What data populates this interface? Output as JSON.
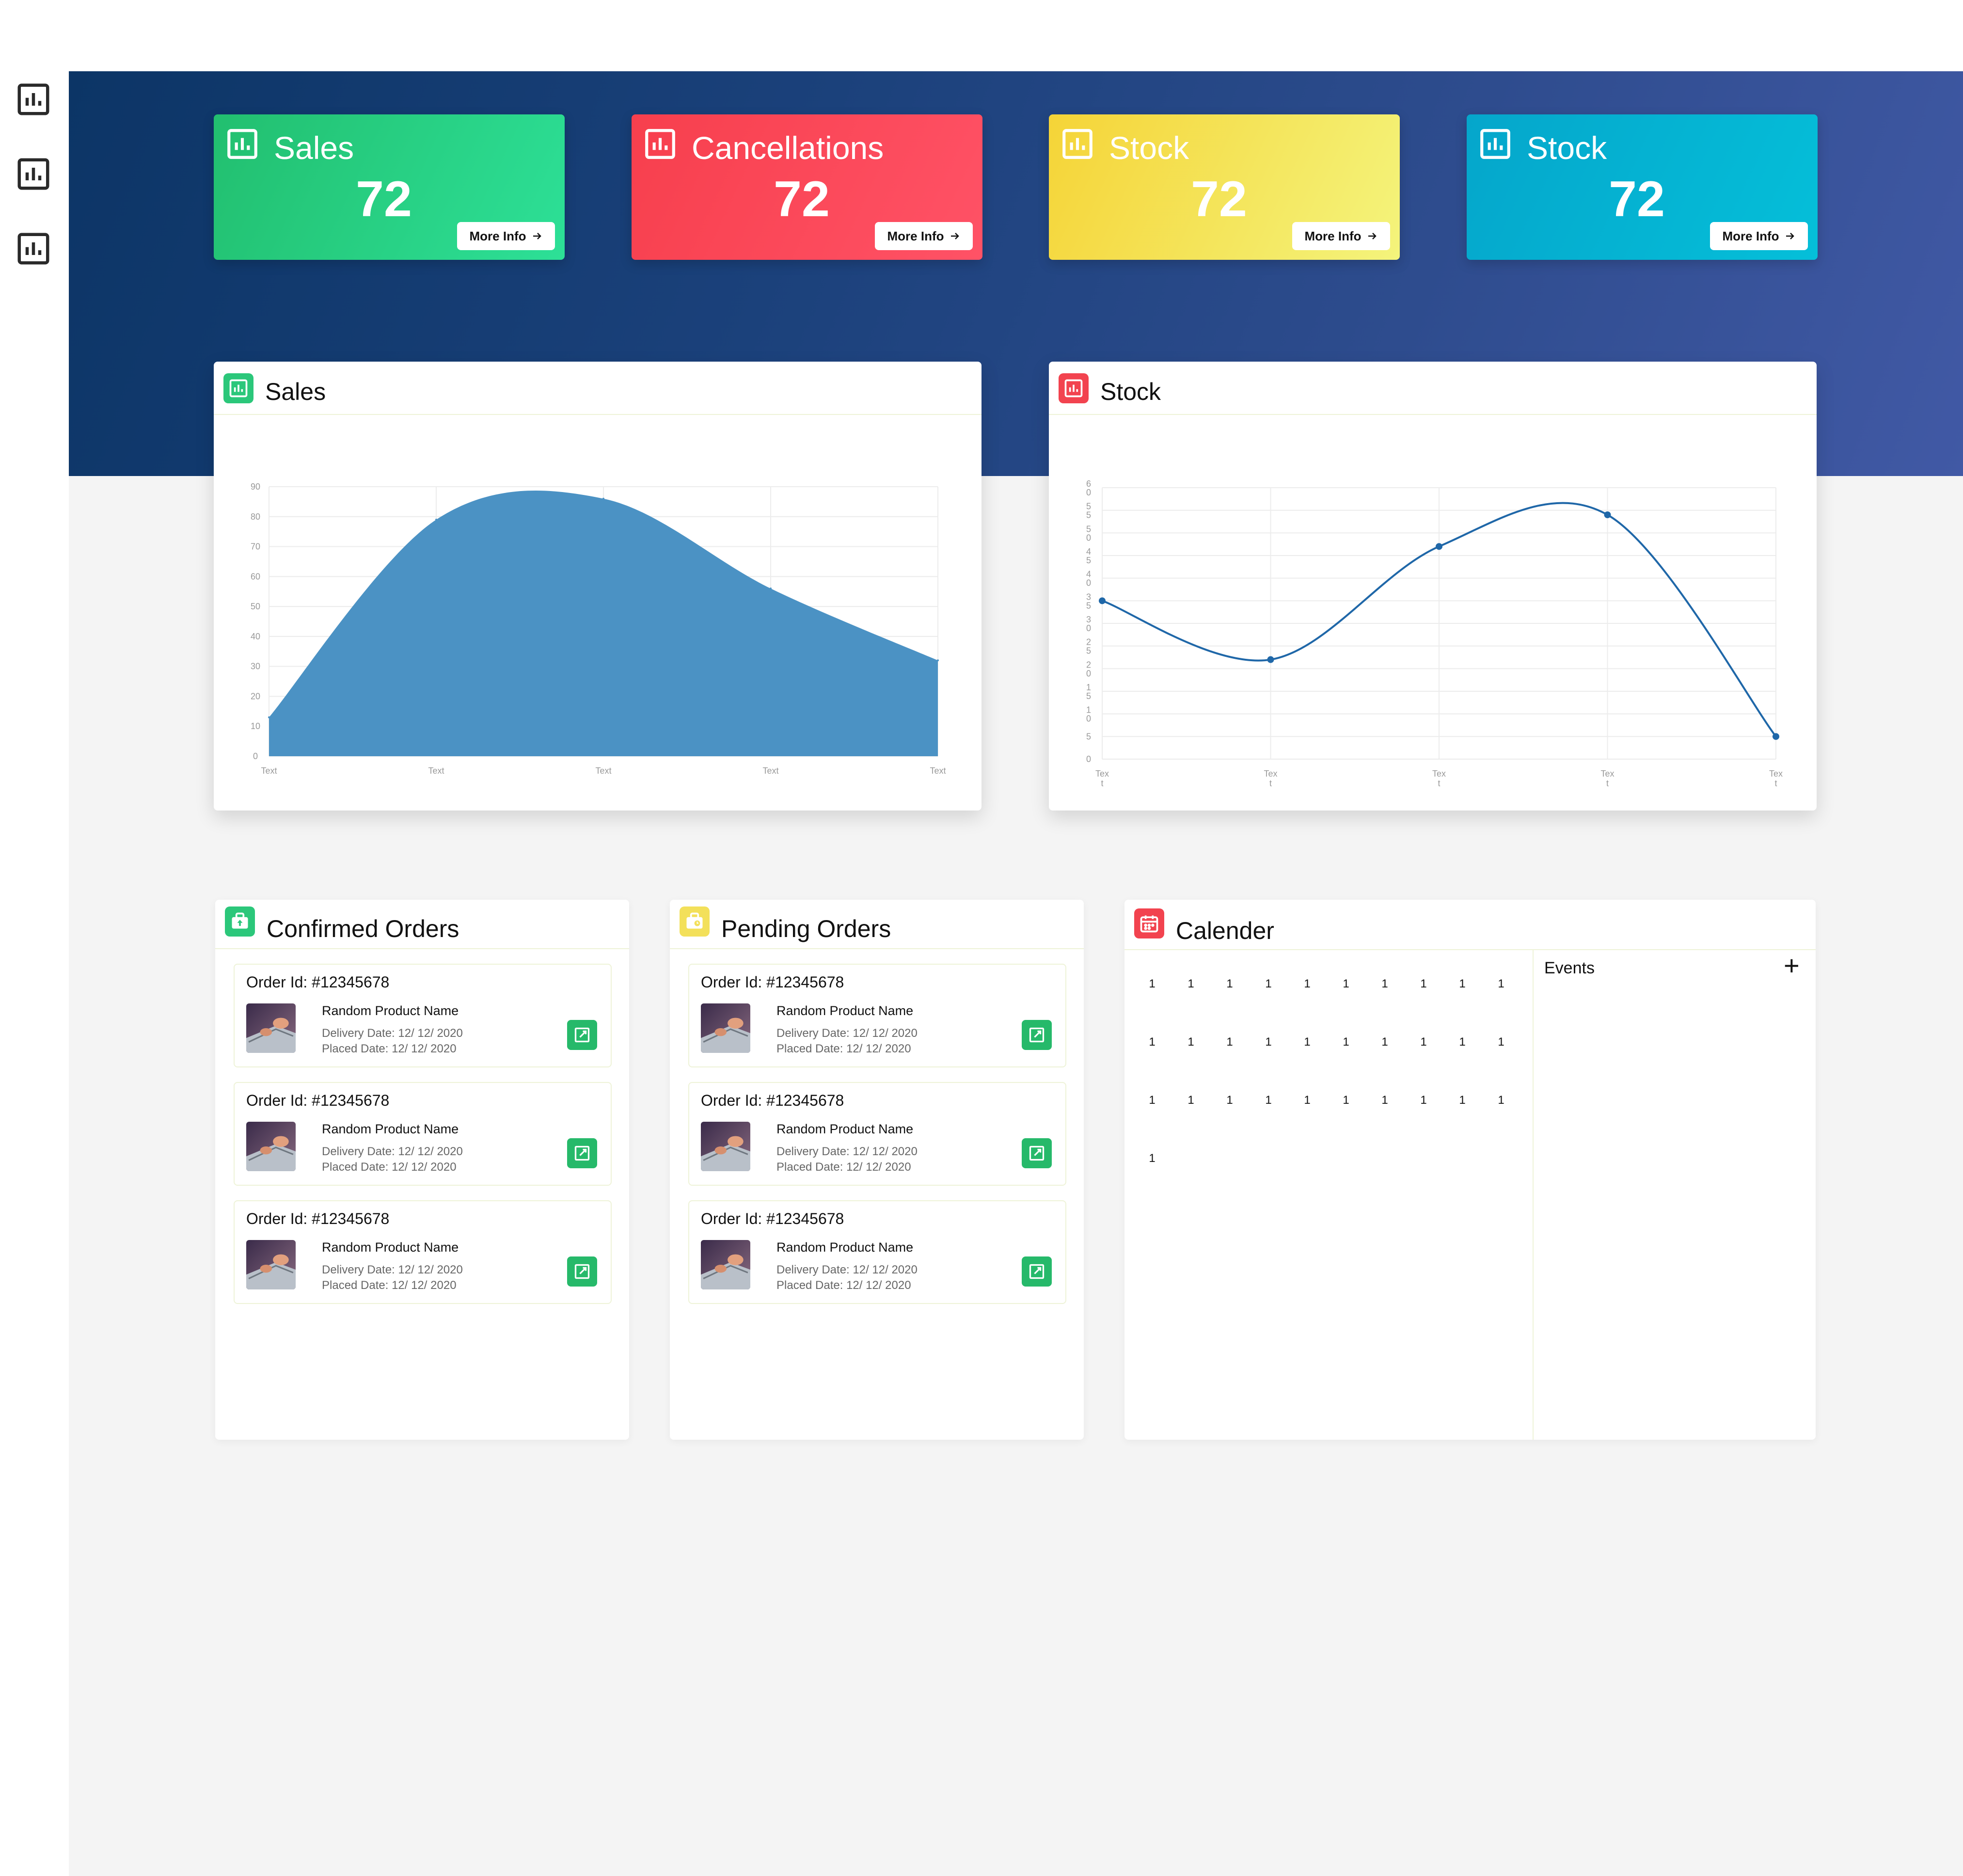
{
  "stat_cards": [
    {
      "title": "Sales",
      "value": "72",
      "button": "More Info"
    },
    {
      "title": "Cancellations",
      "value": "72",
      "button": "More Info"
    },
    {
      "title": "Stock",
      "value": "72",
      "button": "More Info"
    },
    {
      "title": "Stock",
      "value": "72",
      "button": "More Info"
    }
  ],
  "sidebar": {
    "items": [
      {
        "icon": "bar-chart-icon"
      },
      {
        "icon": "bar-chart-icon"
      },
      {
        "icon": "bar-chart-icon"
      }
    ]
  },
  "colors": {
    "sales": "#26c77d",
    "cancellations": "#fd4758",
    "stock_yellow": "#f2e15b",
    "stock_blue": "#08b3d4",
    "area_fill": "#4b92c4",
    "line_stroke": "#1f67a8",
    "open_button": "#26b96a"
  },
  "sales_panel": {
    "title": "Sales"
  },
  "stock_panel": {
    "title": "Stock"
  },
  "chart_data": [
    {
      "type": "area",
      "title": "Sales",
      "categories": [
        "Text",
        "Text",
        "Text",
        "Text",
        "Text"
      ],
      "values": [
        13,
        79,
        86,
        56,
        32
      ],
      "ylim": [
        0,
        90
      ],
      "yticks": [
        "90",
        "80",
        "70",
        "60",
        "50",
        "40",
        "30",
        "20",
        "10",
        "0"
      ],
      "grid": true,
      "legend": "none"
    },
    {
      "type": "line",
      "title": "Stock",
      "categories": [
        "Tex t",
        "Tex t",
        "Tex t",
        "Tex t",
        "Tex t"
      ],
      "values": [
        35,
        22,
        47,
        54,
        5
      ],
      "ylim": [
        0,
        60
      ],
      "yticks": [
        "6 0",
        "5 5",
        "5 0",
        "4 5",
        "4 0",
        "3 5",
        "3 0",
        "2 5",
        "2 0",
        "1 5",
        "1 0",
        "5",
        "0"
      ],
      "grid": true,
      "legend": "none"
    }
  ],
  "confirmed_orders": {
    "title": "Confirmed Orders",
    "orders": [
      {
        "order_id": "Order Id: #12345678",
        "product": "Random Product Name",
        "delivery": "Delivery Date: 12/ 12/ 2020",
        "placed": "Placed Date: 12/ 12/ 2020"
      },
      {
        "order_id": "Order Id: #12345678",
        "product": "Random Product Name",
        "delivery": "Delivery Date: 12/ 12/ 2020",
        "placed": "Placed Date: 12/ 12/ 2020"
      },
      {
        "order_id": "Order Id: #12345678",
        "product": "Random Product Name",
        "delivery": "Delivery Date: 12/ 12/ 2020",
        "placed": "Placed Date: 12/ 12/ 2020"
      }
    ]
  },
  "pending_orders": {
    "title": "Pending Orders",
    "orders": [
      {
        "order_id": "Order Id: #12345678",
        "product": "Random Product Name",
        "delivery": "Delivery Date: 12/ 12/ 2020",
        "placed": "Placed Date: 12/ 12/ 2020"
      },
      {
        "order_id": "Order Id: #12345678",
        "product": "Random Product Name",
        "delivery": "Delivery Date: 12/ 12/ 2020",
        "placed": "Placed Date: 12/ 12/ 2020"
      },
      {
        "order_id": "Order Id: #12345678",
        "product": "Random Product Name",
        "delivery": "Delivery Date: 12/ 12/ 2020",
        "placed": "Placed Date: 12/ 12/ 2020"
      }
    ]
  },
  "calendar": {
    "title": "Calender",
    "days": [
      "1",
      "1",
      "1",
      "1",
      "1",
      "1",
      "1",
      "1",
      "1",
      "1",
      "1",
      "1",
      "1",
      "1",
      "1",
      "1",
      "1",
      "1",
      "1",
      "1",
      "1",
      "1",
      "1",
      "1",
      "1",
      "1",
      "1",
      "1",
      "1",
      "1",
      "1"
    ],
    "events_label": "Events",
    "add_label": "+"
  }
}
